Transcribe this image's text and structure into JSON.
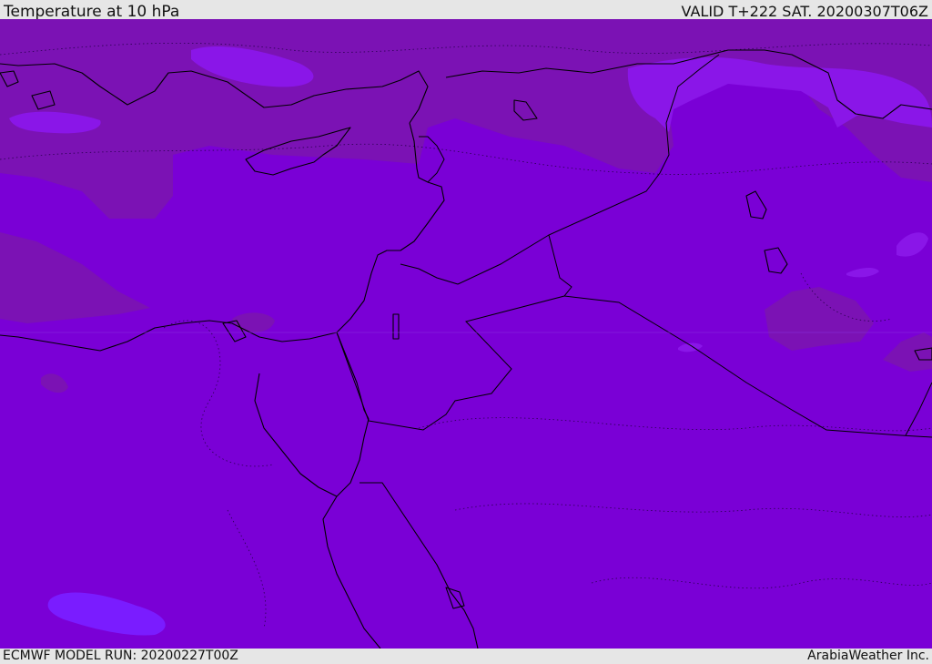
{
  "header": {
    "title": "Temperature at 10 hPa",
    "valid_time": "VALID T+222 SAT. 20200307T06Z"
  },
  "footer": {
    "model_run": "ECMWF MODEL RUN: 20200227T00Z",
    "credit": "ArabiaWeather Inc."
  },
  "map": {
    "colors": {
      "base_field": "#7a00d6",
      "cooler_field": "#7b12b4",
      "warmer_field": "#8a16e8",
      "warm_patch": "#7f1ff2",
      "warmest_patch": "#7a1cff",
      "coastline": "#000000"
    }
  }
}
